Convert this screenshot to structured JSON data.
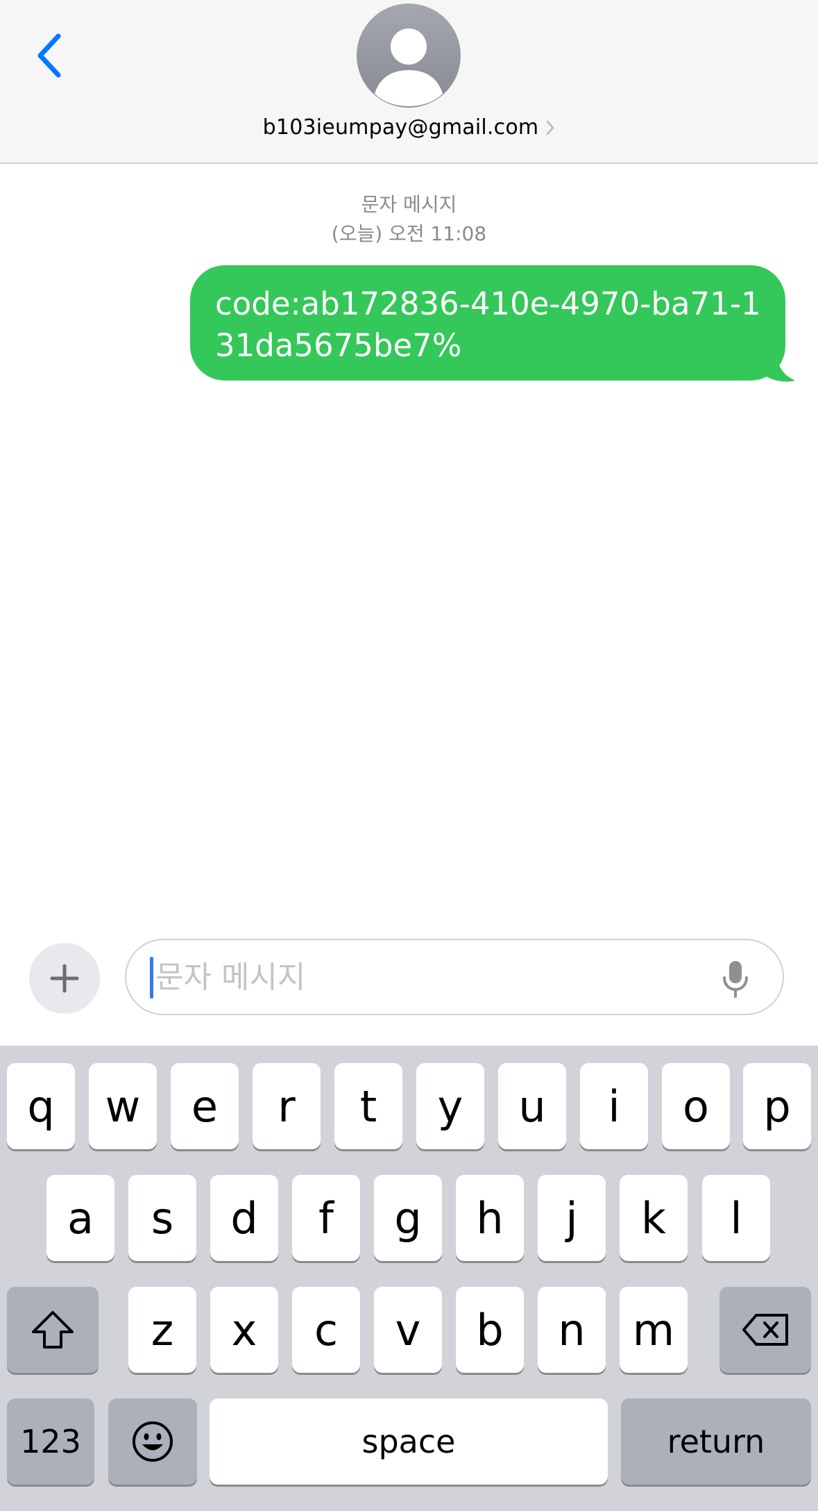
{
  "header": {
    "contact": "b103ieumpay@gmail.com"
  },
  "thread": {
    "service_label": "문자 메시지",
    "timestamp": "(오늘) 오전 11:08",
    "messages": [
      {
        "direction": "outgoing",
        "text": "code:ab172836-410e-4970-ba71-131da5675be7%"
      }
    ]
  },
  "composer": {
    "placeholder": "문자 메시지"
  },
  "keyboard": {
    "row1": [
      "q",
      "w",
      "e",
      "r",
      "t",
      "y",
      "u",
      "i",
      "o",
      "p"
    ],
    "row2": [
      "a",
      "s",
      "d",
      "f",
      "g",
      "h",
      "j",
      "k",
      "l"
    ],
    "row3": [
      "z",
      "x",
      "c",
      "v",
      "b",
      "n",
      "m"
    ],
    "numbers_label": "123",
    "space_label": "space",
    "return_label": "return"
  },
  "icons": {
    "back": "chevron-left-icon",
    "avatar": "person-icon",
    "plus": "plus-icon",
    "mic": "microphone-icon",
    "shift": "shift-icon",
    "delete": "delete-backspace-icon",
    "emoji": "emoji-icon"
  },
  "colors": {
    "accent": "#007aff",
    "bubble": "#34c759",
    "keyboard_bg": "#d1d3d9",
    "function_key": "#abb0bb"
  }
}
